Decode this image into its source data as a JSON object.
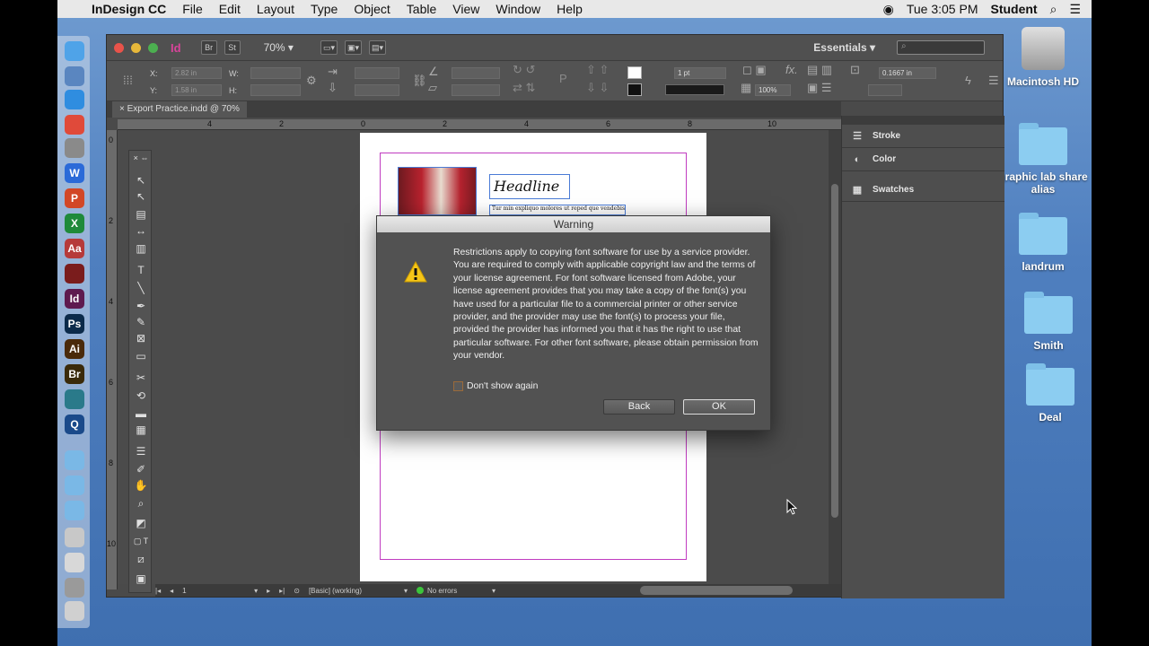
{
  "menubar": {
    "app_name": "InDesign CC",
    "items": [
      "File",
      "Edit",
      "Layout",
      "Type",
      "Object",
      "Table",
      "View",
      "Window",
      "Help"
    ],
    "clock": "Tue 3:05 PM",
    "user": "Student"
  },
  "dock": {
    "icons": [
      {
        "name": "finder-icon",
        "glyph": "",
        "color": "#4fa3e8"
      },
      {
        "name": "launchpad-icon",
        "glyph": "",
        "color": "#5a86c0"
      },
      {
        "name": "safari-icon",
        "glyph": "",
        "color": "#2f8de0"
      },
      {
        "name": "chrome-icon",
        "glyph": "",
        "color": "#e04a3a"
      },
      {
        "name": "preview-icon",
        "glyph": "",
        "color": "#8a8a8a"
      },
      {
        "name": "word-icon",
        "glyph": "W",
        "color": "#2b6ad8"
      },
      {
        "name": "powerpoint-icon",
        "glyph": "P",
        "color": "#d24726"
      },
      {
        "name": "excel-icon",
        "glyph": "X",
        "color": "#1f8a3a"
      },
      {
        "name": "acrobat-icon",
        "glyph": "Aa",
        "color": "#b63a3a"
      },
      {
        "name": "acrobat-reader-icon",
        "glyph": "",
        "color": "#7a1c1c"
      },
      {
        "name": "indesign-icon",
        "glyph": "Id",
        "color": "#5e1a4f"
      },
      {
        "name": "photoshop-icon",
        "glyph": "Ps",
        "color": "#0b2a4a"
      },
      {
        "name": "illustrator-icon",
        "glyph": "Ai",
        "color": "#4a2a0a"
      },
      {
        "name": "bridge-icon",
        "glyph": "Br",
        "color": "#3a2a0a"
      },
      {
        "name": "screen-icon",
        "glyph": "",
        "color": "#2a7a8a"
      },
      {
        "name": "quicktime-icon",
        "glyph": "Q",
        "color": "#1a4a8a"
      },
      {
        "name": "applications-folder-icon",
        "glyph": "",
        "color": "#7ab8e6"
      },
      {
        "name": "documents-folder-icon",
        "glyph": "",
        "color": "#7ab8e6"
      },
      {
        "name": "downloads-folder-icon",
        "glyph": "",
        "color": "#7ab8e6"
      },
      {
        "name": "mail-icon",
        "glyph": "",
        "color": "#c8c8c8"
      },
      {
        "name": "notes-icon",
        "glyph": "",
        "color": "#d8d8d8"
      },
      {
        "name": "preferences-icon",
        "glyph": "",
        "color": "#9a9a9a"
      },
      {
        "name": "trash-icon",
        "glyph": "",
        "color": "#d0d0d0"
      }
    ]
  },
  "desktop": {
    "items": [
      {
        "name": "macintosh-hd",
        "label": "Macintosh HD"
      },
      {
        "name": "graphic-lab-share-alias",
        "label": "graphic lab share alias"
      },
      {
        "name": "landrum-folder",
        "label": "landrum"
      },
      {
        "name": "smith-folder",
        "label": "Smith"
      },
      {
        "name": "deal-folder",
        "label": "Deal"
      }
    ]
  },
  "indesign": {
    "logo": "Id",
    "bridge_btn": "Br",
    "stock_btn": "St",
    "zoom": "70%",
    "workspace": "Essentials",
    "control": {
      "x_label": "X:",
      "x_value": "2.82 in",
      "y_label": "Y:",
      "y_value": "1.58 in",
      "w_label": "W:",
      "h_label": "H:",
      "stroke_weight": "1 pt",
      "opacity": "100%",
      "gap": "0.1667 in",
      "fx_label": "fx."
    },
    "doc_tab": "Export Practice.indd @ 70%",
    "hruler_labels": [
      "4",
      "2",
      "0",
      "2",
      "4",
      "6",
      "8",
      "10"
    ],
    "vruler_labels": [
      "0",
      "2",
      "4",
      "6",
      "8",
      "10"
    ],
    "page": {
      "headline": "Headline",
      "body_text": "Tur min expliquo molores ut reped que vendebis"
    },
    "status": {
      "page": "1",
      "style": "[Basic] (working)",
      "errors": "No errors"
    },
    "panels": [
      {
        "name": "stroke",
        "label": "Stroke",
        "glyph": "☰"
      },
      {
        "name": "color",
        "label": "Color",
        "glyph": "◐"
      },
      {
        "name": "swatches",
        "label": "Swatches",
        "glyph": "▦"
      }
    ]
  },
  "dialog": {
    "title": "Warning",
    "message": "Restrictions apply to copying font software for use by a service provider.  You are required to comply with applicable copyright law and the terms of your license agreement.  For font software licensed from Adobe, your license agreement provides that you may take a copy of the font(s) you have used for a particular file to a commercial printer or other service provider, and the provider may use the font(s) to process your file, provided the provider has informed you that it has the right to use that particular software.  For other font software, please obtain permission from your vendor.",
    "checkbox_label": "Don't show again",
    "back_label": "Back",
    "ok_label": "OK"
  }
}
